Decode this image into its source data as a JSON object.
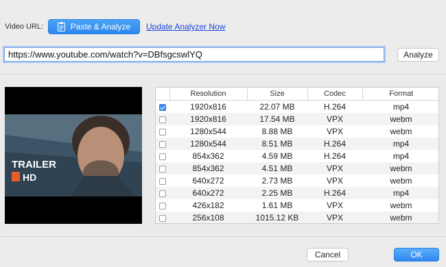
{
  "top": {
    "video_url_label": "Video URL:",
    "paste_button": "Paste & Analyze",
    "update_link": "Update Analyzer Now",
    "url_value": "https://www.youtube.com/watch?v=DBfsgcswlYQ",
    "analyze_button": "Analyze"
  },
  "thumbnail": {
    "badge_line1": "TRAILER",
    "badge_line2": "HD"
  },
  "table": {
    "headers": [
      "",
      "Resolution",
      "Size",
      "Codec",
      "Format"
    ],
    "rows": [
      {
        "checked": true,
        "resolution": "1920x816",
        "size": "22.07 MB",
        "codec": "H.264",
        "format": "mp4"
      },
      {
        "checked": false,
        "resolution": "1920x816",
        "size": "17.54 MB",
        "codec": "VPX",
        "format": "webm"
      },
      {
        "checked": false,
        "resolution": "1280x544",
        "size": "8.88 MB",
        "codec": "VPX",
        "format": "webm"
      },
      {
        "checked": false,
        "resolution": "1280x544",
        "size": "8.51 MB",
        "codec": "H.264",
        "format": "mp4"
      },
      {
        "checked": false,
        "resolution": "854x362",
        "size": "4.59 MB",
        "codec": "H.264",
        "format": "mp4"
      },
      {
        "checked": false,
        "resolution": "854x362",
        "size": "4.51 MB",
        "codec": "VPX",
        "format": "webm"
      },
      {
        "checked": false,
        "resolution": "640x272",
        "size": "2.73 MB",
        "codec": "VPX",
        "format": "webm"
      },
      {
        "checked": false,
        "resolution": "640x272",
        "size": "2.25 MB",
        "codec": "H.264",
        "format": "mp4"
      },
      {
        "checked": false,
        "resolution": "426x182",
        "size": "1.61 MB",
        "codec": "VPX",
        "format": "webm"
      },
      {
        "checked": false,
        "resolution": "256x108",
        "size": "1015.12 KB",
        "codec": "VPX",
        "format": "webm"
      }
    ]
  },
  "footer": {
    "cancel_button": "Cancel",
    "ok_button": "OK"
  },
  "colors": {
    "accent": "#2d87ee",
    "link": "#1a45d8",
    "window_bg": "#ececec"
  }
}
